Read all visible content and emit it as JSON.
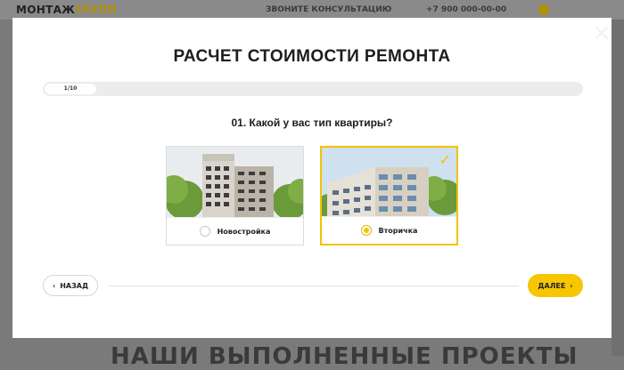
{
  "background": {
    "logo_main": "МОНТАЖ",
    "logo_accent": "ГРУПП",
    "nav_text": "ЗВОНИТЕ КОНСУЛЬТАЦИЮ",
    "phone": "+7 900 000-00-00",
    "section_title": "НАШИ ВЫПОЛНЕННЫЕ ПРОЕКТЫ"
  },
  "modal": {
    "close_glyph": "×",
    "title": "РАСЧЕТ СТОИМОСТИ РЕМОНТА",
    "progress": {
      "label": "1/10",
      "current": 1,
      "total": 10
    },
    "question": "01. Какой у вас тип квартиры?",
    "options": [
      {
        "label": "Новостройка",
        "selected": false,
        "icon": "new-building-photo"
      },
      {
        "label": "Вторичка",
        "selected": true,
        "icon": "old-building-photo"
      }
    ],
    "back_label": "НАЗАД",
    "back_icon": "chevron-left-icon",
    "next_label": "ДАЛЕЕ",
    "next_icon": "chevron-right-icon",
    "check_glyph": "✓",
    "colors": {
      "accent": "#f7c600",
      "text": "#1d1d1d"
    }
  }
}
